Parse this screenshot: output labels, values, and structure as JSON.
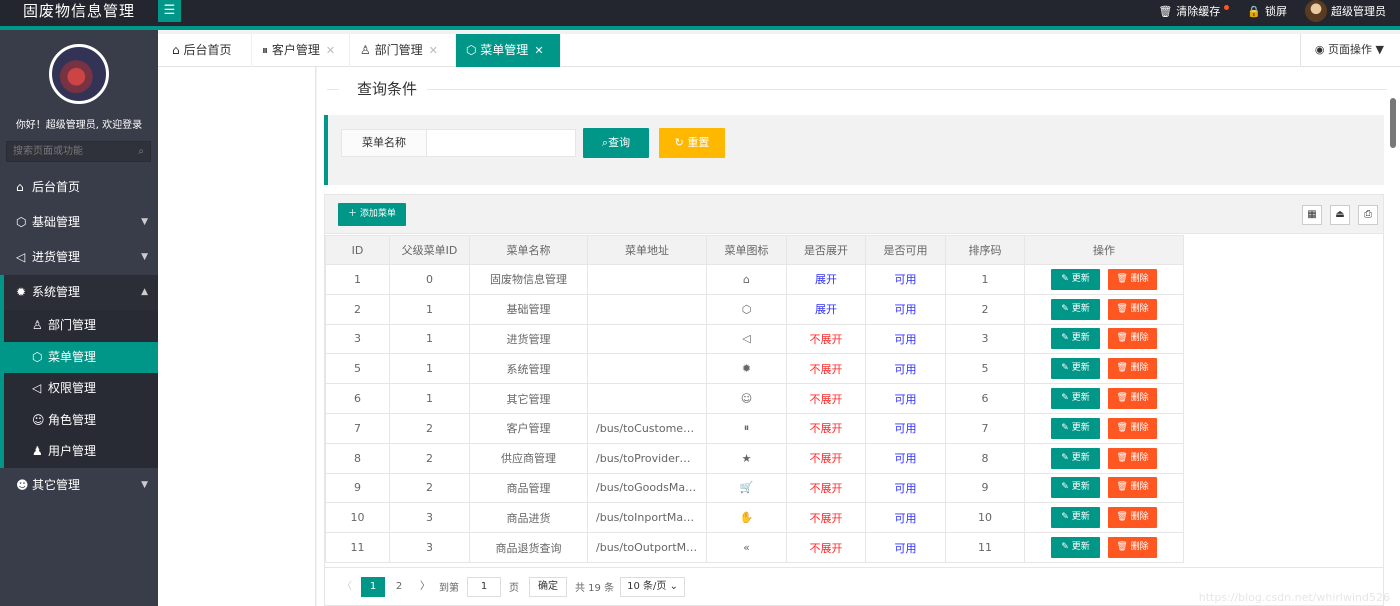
{
  "header": {
    "title": "固废物信息管理",
    "menu_icon": "hamburger-icon",
    "clear_cache": "清除缓存",
    "lock_screen": "锁屏",
    "user": "超级管理员"
  },
  "sidebar": {
    "welcome": "你好！超级管理员, 欢迎登录",
    "search_placeholder": "搜索页面或功能",
    "items": [
      {
        "label": "后台首页",
        "icon": "home-icon"
      },
      {
        "label": "基础管理",
        "icon": "cube-icon"
      },
      {
        "label": "进货管理",
        "icon": "speaker-icon"
      },
      {
        "label": "系统管理",
        "icon": "gear-icon"
      }
    ],
    "sub_items": [
      {
        "label": "部门管理",
        "icon": "user-outline-icon"
      },
      {
        "label": "菜单管理",
        "icon": "cube-icon"
      },
      {
        "label": "权限管理",
        "icon": "speaker-icon"
      },
      {
        "label": "角色管理",
        "icon": "smile-icon"
      },
      {
        "label": "用户管理",
        "icon": "user-icon"
      }
    ],
    "last_item": {
      "label": "其它管理",
      "icon": "face-icon"
    }
  },
  "tabs": [
    {
      "label": "后台首页",
      "closable": false
    },
    {
      "label": "客户管理",
      "closable": true
    },
    {
      "label": "部门管理",
      "closable": true
    },
    {
      "label": "菜单管理",
      "closable": true,
      "active": true
    }
  ],
  "page_ops": "页面操作",
  "query": {
    "legend": "查询条件",
    "menu_name_label": "菜单名称",
    "menu_name_value": "",
    "search_button": "查询",
    "reset_button": "重置"
  },
  "table": {
    "add_button": "添加菜单",
    "headers": [
      "ID",
      "父级菜单ID",
      "菜单名称",
      "菜单地址",
      "菜单图标",
      "是否展开",
      "是否可用",
      "排序码",
      "操作"
    ],
    "update_label": "更新",
    "delete_label": "删除",
    "rows": [
      {
        "id": "1",
        "pid": "0",
        "name": "固废物信息管理",
        "url": "",
        "icon": "⌂",
        "spread": "展开",
        "spread_open": true,
        "available": "可用",
        "order": "1"
      },
      {
        "id": "2",
        "pid": "1",
        "name": "基础管理",
        "url": "",
        "icon": "⬡",
        "spread": "展开",
        "spread_open": true,
        "available": "可用",
        "order": "2"
      },
      {
        "id": "3",
        "pid": "1",
        "name": "进货管理",
        "url": "",
        "icon": "◁",
        "spread": "不展开",
        "spread_open": false,
        "available": "可用",
        "order": "3"
      },
      {
        "id": "5",
        "pid": "1",
        "name": "系统管理",
        "url": "",
        "icon": "✹",
        "spread": "不展开",
        "spread_open": false,
        "available": "可用",
        "order": "5"
      },
      {
        "id": "6",
        "pid": "1",
        "name": "其它管理",
        "url": "",
        "icon": "☺",
        "spread": "不展开",
        "spread_open": false,
        "available": "可用",
        "order": "6"
      },
      {
        "id": "7",
        "pid": "2",
        "name": "客户管理",
        "url": "/bus/toCustomer…",
        "icon": "⏸",
        "spread": "不展开",
        "spread_open": false,
        "available": "可用",
        "order": "7"
      },
      {
        "id": "8",
        "pid": "2",
        "name": "供应商管理",
        "url": "/bus/toProviderM…",
        "icon": "★",
        "spread": "不展开",
        "spread_open": false,
        "available": "可用",
        "order": "8"
      },
      {
        "id": "9",
        "pid": "2",
        "name": "商品管理",
        "url": "/bus/toGoodsMa…",
        "icon": "🛒",
        "spread": "不展开",
        "spread_open": false,
        "available": "可用",
        "order": "9"
      },
      {
        "id": "10",
        "pid": "3",
        "name": "商品进货",
        "url": "/bus/toInportMan…",
        "icon": "✋",
        "spread": "不展开",
        "spread_open": false,
        "available": "可用",
        "order": "10"
      },
      {
        "id": "11",
        "pid": "3",
        "name": "商品退货查询",
        "url": "/bus/toOutportM…",
        "icon": "«",
        "spread": "不展开",
        "spread_open": false,
        "available": "可用",
        "order": "11"
      }
    ]
  },
  "pager": {
    "pages": [
      "1",
      "2"
    ],
    "goto_label": "到第",
    "goto_value": "1",
    "page_unit": "页",
    "confirm": "确定",
    "total": "共 19 条",
    "per_page": "10 条/页"
  },
  "watermark": "https://blog.csdn.net/whirlwind526"
}
